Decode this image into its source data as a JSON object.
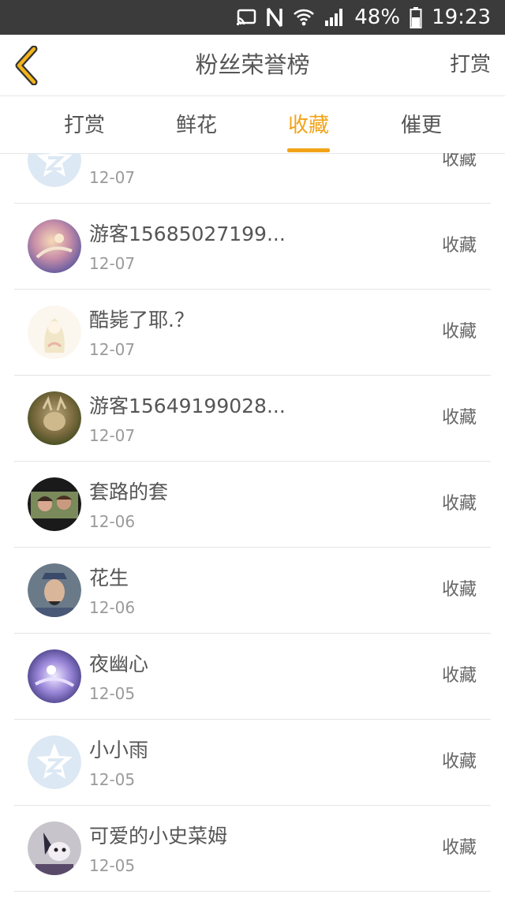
{
  "status_bar": {
    "battery": "48%",
    "time": "19:23"
  },
  "header": {
    "title": "粉丝荣誉榜",
    "right_action": "打赏"
  },
  "tabs": [
    {
      "label": "打赏"
    },
    {
      "label": "鲜花"
    },
    {
      "label": "收藏"
    },
    {
      "label": "催更"
    }
  ],
  "active_tab": "收藏",
  "list": [
    {
      "name": "",
      "date": "12-07",
      "action": "收藏",
      "avatar": "default-q"
    },
    {
      "name": "游客15685027199...",
      "date": "12-07",
      "action": "收藏",
      "avatar": "photo"
    },
    {
      "name": "酷毙了耶.？",
      "date": "12-07",
      "action": "收藏",
      "avatar": "photo"
    },
    {
      "name": "游客15649199028...",
      "date": "12-07",
      "action": "收藏",
      "avatar": "photo"
    },
    {
      "name": "套路的套",
      "date": "12-06",
      "action": "收藏",
      "avatar": "photo"
    },
    {
      "name": "花生",
      "date": "12-06",
      "action": "收藏",
      "avatar": "photo"
    },
    {
      "name": "夜幽心",
      "date": "12-05",
      "action": "收藏",
      "avatar": "photo"
    },
    {
      "name": "小小雨",
      "date": "12-05",
      "action": "收藏",
      "avatar": "default-q"
    },
    {
      "name": "可爱的小史菜姆",
      "date": "12-05",
      "action": "收藏",
      "avatar": "photo"
    }
  ],
  "colors": {
    "accent": "#f2a318",
    "status_bar": "#3b3b3b",
    "text": "#555555",
    "subtext": "#9a9a9a"
  }
}
